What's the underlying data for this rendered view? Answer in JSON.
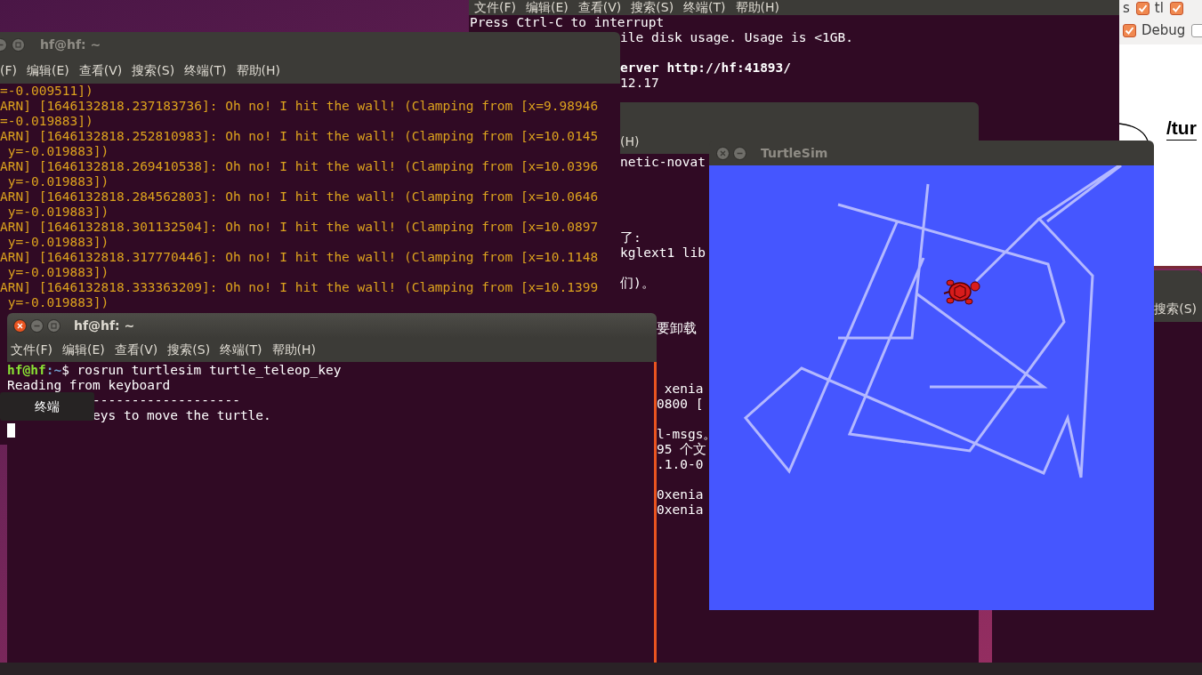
{
  "back_terminal": {
    "menu": [
      "文件(F)",
      "编辑(E)",
      "查看(V)",
      "搜索(S)",
      "终端(T)",
      "帮助(H)"
    ],
    "lines": [
      {
        "text": "Press Ctrl-C to interrupt",
        "kind": "full",
        "bold": false
      },
      {
        "text": "ile disk usage. Usage is <1GB.",
        "kind": "clipped",
        "bold": false
      },
      {
        "text": "erver http://hf:41893/",
        "kind": "clipped",
        "bold": true
      },
      {
        "text": "12.17",
        "kind": "clipped",
        "bold": false
      }
    ]
  },
  "rqt_panel": {
    "top_row": [
      {
        "kind": "label",
        "label": "s"
      },
      {
        "kind": "checkbox",
        "checked": true,
        "label": "tl"
      },
      {
        "kind": "checkbox",
        "checked": true
      }
    ],
    "bottom_row": [
      {
        "kind": "checkbox",
        "checked": true,
        "label": "Debug"
      },
      {
        "kind": "checkbox",
        "checked": false
      }
    ],
    "node_label": "/tur"
  },
  "middle_terminal": {
    "menu": [
      "(H)"
    ],
    "lines": [
      "netic-novat",
      "了:",
      "kglext1 lib",
      "们)。",
      "要卸载",
      " xenia",
      "0800 [",
      "l-msgs。",
      "95 个文",
      ".1.0-0",
      "0xenia",
      "0xenia"
    ]
  },
  "right_terminal": {
    "menu": [
      "搜索(S)"
    ]
  },
  "top_terminal": {
    "title": "hf@hf: ~",
    "menu": [
      "(F)",
      "编辑(E)",
      "查看(V)",
      "搜索(S)",
      "终端(T)",
      "帮助(H)"
    ],
    "lines": [
      "=-0.009511])",
      "ARN] [1646132818.237183736]: Oh no! I hit the wall! (Clamping from [x=9.98946",
      "=-0.019883])",
      "ARN] [1646132818.252810983]: Oh no! I hit the wall! (Clamping from [x=10.0145",
      " y=-0.019883])",
      "ARN] [1646132818.269410538]: Oh no! I hit the wall! (Clamping from [x=10.0396",
      " y=-0.019883])",
      "ARN] [1646132818.284562803]: Oh no! I hit the wall! (Clamping from [x=10.0646",
      " y=-0.019883])",
      "ARN] [1646132818.301132504]: Oh no! I hit the wall! (Clamping from [x=10.0897",
      " y=-0.019883])",
      "ARN] [1646132818.317770446]: Oh no! I hit the wall! (Clamping from [x=10.1148",
      " y=-0.019883])",
      "ARN] [1646132818.333363209]: Oh no! I hit the wall! (Clamping from [x=10.1399",
      " y=-0.019883])"
    ]
  },
  "turtlesim": {
    "title": "TurtleSim"
  },
  "front_terminal": {
    "title": "hf@hf: ~",
    "menu": [
      "文件(F)",
      "编辑(E)",
      "查看(V)",
      "搜索(S)",
      "终端(T)",
      "帮助(H)"
    ],
    "lines": [
      {
        "kind": "prompt",
        "segments": [
          {
            "text": "hf@hf",
            "color": "#8ae234"
          },
          {
            "text": ":~",
            "color": "#729fcf"
          },
          {
            "text": "$ rosrun turtlesim turtle_teleop_key",
            "color": "#ffffff"
          }
        ]
      },
      {
        "kind": "text",
        "text": "Reading from keyboard"
      },
      {
        "kind": "covered",
        "text": "-------------------"
      },
      {
        "kind": "covered",
        "text": "eys to move the turtle."
      }
    ],
    "cursor": true
  },
  "tooltip": {
    "text": "终端"
  }
}
